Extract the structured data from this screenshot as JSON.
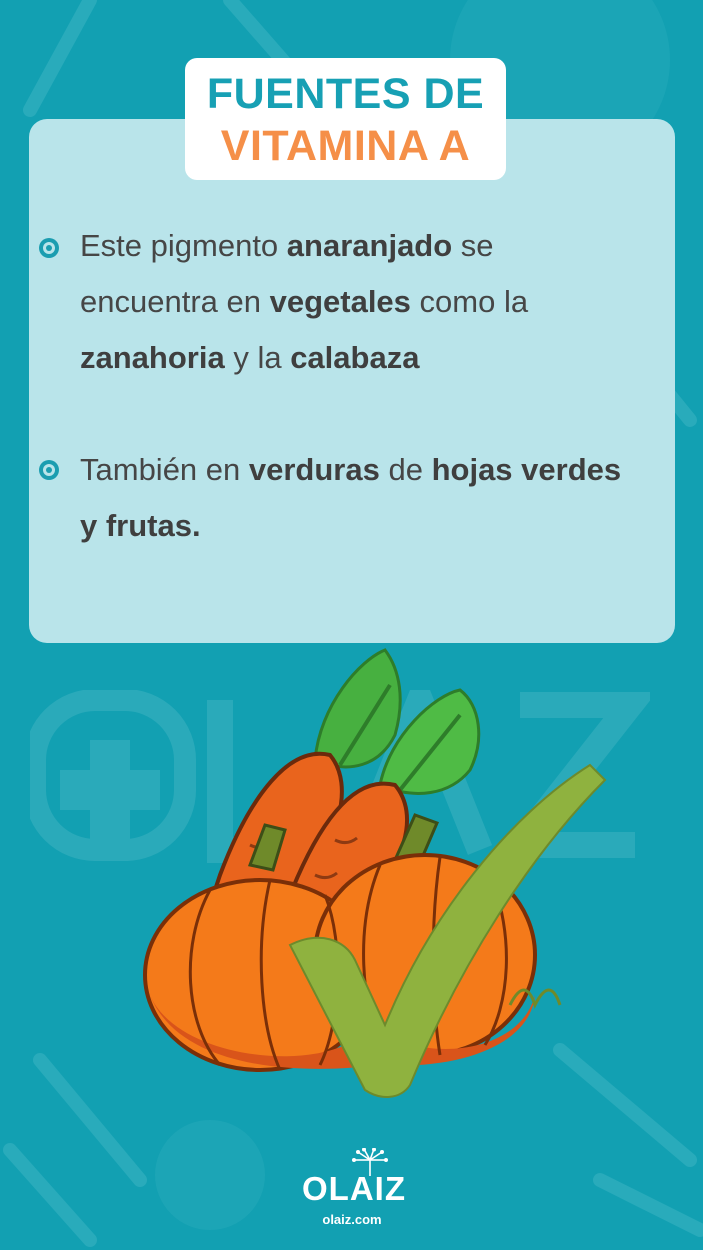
{
  "colors": {
    "background": "#12a0b2",
    "card": "#b9e4ea",
    "title_teal": "#17a0b4",
    "title_orange": "#f58f48",
    "body_text": "#464646",
    "carrot": "#e9641d",
    "pumpkin": "#f47a1a",
    "leaves": "#47b040",
    "check": "#8fb23f"
  },
  "title": {
    "line1": "FUENTES DE",
    "line2": "VITAMINA A"
  },
  "bullets": [
    {
      "icon": "circle-bullet-icon",
      "parts": [
        {
          "t": "Este pigmento ",
          "b": false
        },
        {
          "t": "anaranjado",
          "b": true
        },
        {
          "t": " se encuentra en ",
          "b": false
        },
        {
          "t": "vegetales",
          "b": true
        },
        {
          "t": " como la ",
          "b": false
        },
        {
          "t": "zanahoria",
          "b": true
        },
        {
          "t": " y la ",
          "b": false
        },
        {
          "t": "calabaza",
          "b": true
        }
      ]
    },
    {
      "icon": "circle-bullet-icon",
      "parts": [
        {
          "t": " También en ",
          "b": false
        },
        {
          "t": "verduras",
          "b": true
        },
        {
          "t": " de ",
          "b": false
        },
        {
          "t": "hojas verdes y frutas.",
          "b": true
        }
      ]
    }
  ],
  "illustration": {
    "items": [
      "carrot-icon",
      "carrot-icon",
      "pumpkin-icon",
      "checkmark-icon"
    ]
  },
  "footer": {
    "logo": "OLAIZ",
    "domain": "olaiz.com"
  }
}
